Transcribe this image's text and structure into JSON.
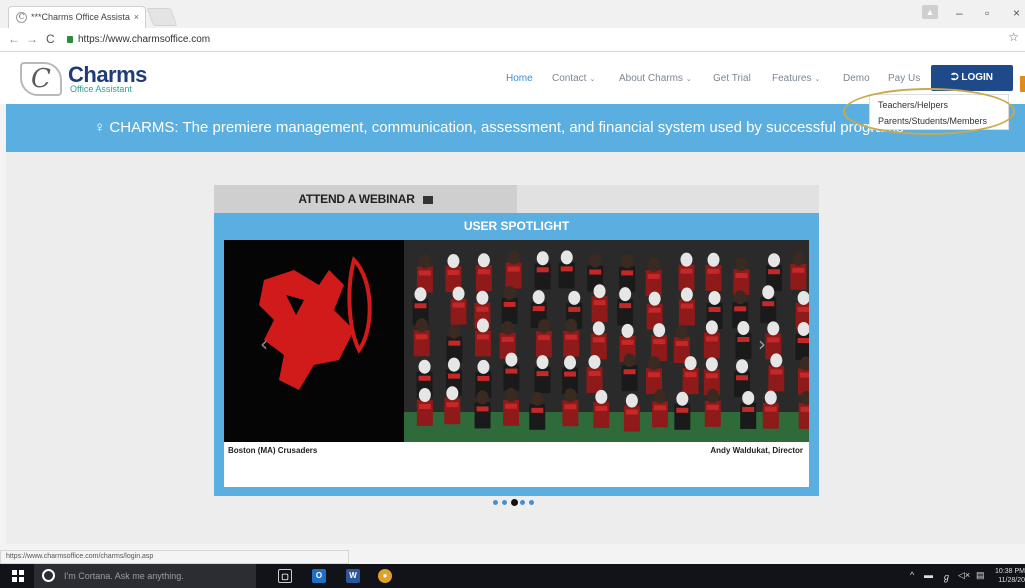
{
  "browser": {
    "tab_title": "***Charms Office Assista",
    "tab_close": "×",
    "url": "https://www.charmsoffice.com",
    "status_url": "https://www.charmsoffice.com/charms/login.asp",
    "controls": {
      "minimize": "–",
      "maximize": "▫",
      "close": "×"
    },
    "nav": {
      "back": "←",
      "forward": "→",
      "reload": "C"
    },
    "bookmark_star": "☆"
  },
  "site": {
    "logo": {
      "mark": "C",
      "name": "Charms",
      "subtitle": "Office Assistant"
    },
    "nav": [
      {
        "label": "Home",
        "active": true
      },
      {
        "label": "Contact",
        "dropdown": true
      },
      {
        "label": "About Charms",
        "dropdown": true
      },
      {
        "label": "Get Trial"
      },
      {
        "label": "Features",
        "dropdown": true
      },
      {
        "label": "Demo"
      },
      {
        "label": "Pay Us"
      }
    ],
    "caret": "⌄",
    "login": {
      "icon": "⮊",
      "label": "LOGIN"
    },
    "login_menu": [
      "Teachers/Helpers",
      "Parents/Students/Members"
    ],
    "banner": {
      "icon": "♀",
      "text": "CHARMS: The premiere management, communication, assessment, and financial system used by successful programs"
    },
    "webinar": {
      "label": "ATTEND A WEBINAR"
    },
    "spotlight": {
      "title": "USER SPOTLIGHT",
      "caption_left": "Boston (MA) Crusaders",
      "caption_right": "Andy Waldukat, Director",
      "prev": "‹",
      "next": "›",
      "slide_count": 5,
      "active_index": 2
    }
  },
  "taskbar": {
    "cortana_placeholder": "I'm Cortana. Ask me anything.",
    "apps": [
      {
        "name": "task-view",
        "glyph": "▢",
        "color": "#111319"
      },
      {
        "name": "outlook",
        "glyph": "O",
        "color": "#1f6fc5"
      },
      {
        "name": "word",
        "glyph": "W",
        "color": "#2b579a"
      },
      {
        "name": "chrome",
        "glyph": "●",
        "color": "#e0a12a"
      }
    ],
    "clock": {
      "time": "10:38 PM",
      "date": "11/28/20"
    }
  }
}
